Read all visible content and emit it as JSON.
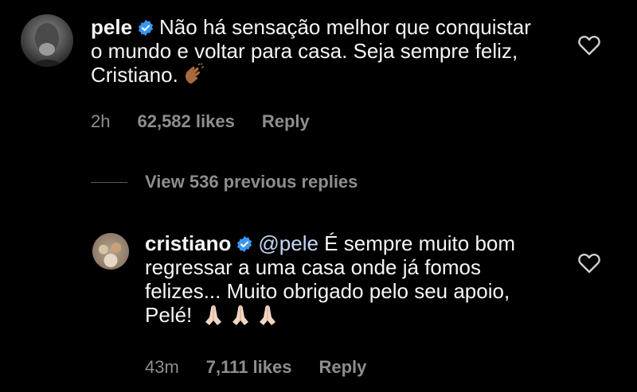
{
  "comment": {
    "username": "pele",
    "text": "Não há sensação melhor que conquistar o mundo e voltar para casa. Seja sempre feliz, Cristiano.",
    "emoji": "clapping-hands-icon",
    "time": "2h",
    "likes": "62,582 likes",
    "reply_label": "Reply"
  },
  "view_replies": "View 536 previous replies",
  "reply": {
    "username": "cristiano",
    "mention": "@pele",
    "text": "É sempre muito bom regressar a uma casa onde já fomos felizes... Muito obrigado pelo seu apoio, Pelé!",
    "emoji": "folded-hands-icon",
    "time": "43m",
    "likes": "7,111 likes",
    "reply_label": "Reply"
  },
  "colors": {
    "background": "#000000",
    "text": "#f5f5f5",
    "meta": "#8e8e8e",
    "verified": "#3897f0",
    "mention": "#c4d7f5"
  }
}
